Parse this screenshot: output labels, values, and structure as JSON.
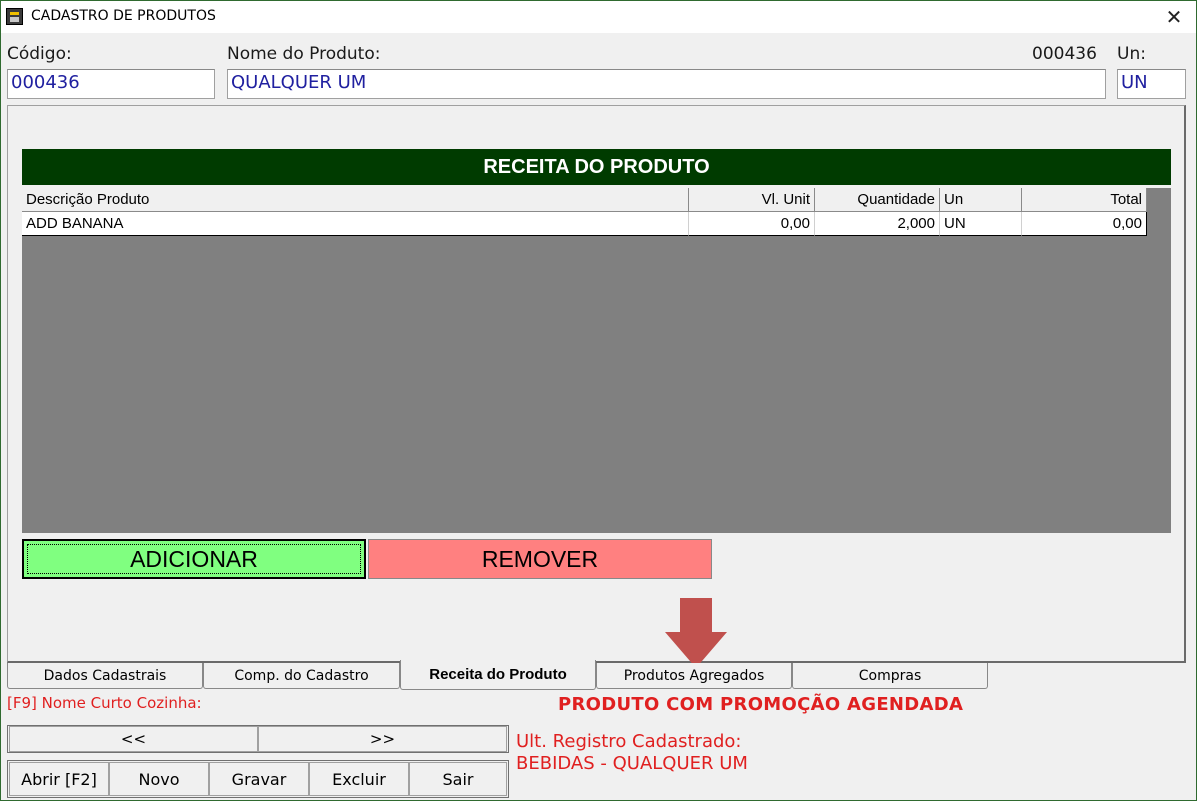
{
  "window": {
    "title": "CADASTRO DE PRODUTOS",
    "close_glyph": "✕"
  },
  "form": {
    "codigo_label": "Código:",
    "codigo_value": "000436",
    "nome_label": "Nome do Produto:",
    "nome_value": "QUALQUER UM",
    "record_code": "000436",
    "un_label": "Un:",
    "un_value": "UN"
  },
  "recipe": {
    "header": "RECEITA DO PRODUTO",
    "columns": [
      "Descrição Produto",
      "Vl. Unit",
      "Quantidade",
      "Un",
      "Total"
    ],
    "rows": [
      {
        "descricao": "ADD BANANA",
        "vl_unit": "0,00",
        "quantidade": "2,000",
        "un": "UN",
        "total": "0,00"
      }
    ],
    "add_label": "ADICIONAR",
    "remove_label": "REMOVER",
    "add_color": "#80ff80",
    "remove_color": "#ff8080",
    "header_color": "#003b00"
  },
  "tabs": [
    {
      "label": "Dados Cadastrais",
      "active": false
    },
    {
      "label": "Comp. do Cadastro",
      "active": false
    },
    {
      "label": "Receita do Produto",
      "active": true
    },
    {
      "label": "Produtos Agregados",
      "active": false
    },
    {
      "label": "Compras",
      "active": false
    }
  ],
  "footer": {
    "f9_label": "[F9] Nome Curto Cozinha:",
    "promo_text": "PRODUTO COM PROMOÇÃO AGENDADA",
    "prev_label": "<<",
    "next_label": ">>",
    "ult_label": "Ult. Registro Cadastrado:",
    "ult_value": "BEBIDAS - QUALQUER UM",
    "abrir_label": "Abrir [F2]",
    "novo_label": "Novo",
    "gravar_label": "Gravar",
    "excluir_label": "Excluir",
    "sair_label": "Sair",
    "alert_color": "#e02020"
  },
  "annotation": {
    "arrow_color": "#c0504d",
    "arrow_icon": "down-arrow-icon"
  }
}
